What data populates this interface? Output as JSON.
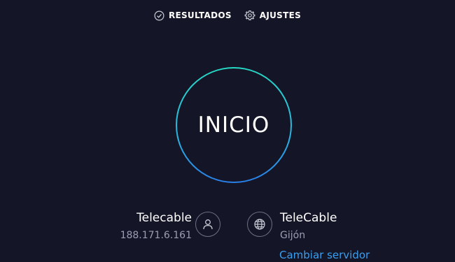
{
  "nav": {
    "results": {
      "label": "RESULTADOS",
      "icon": "check-circle-icon"
    },
    "settings": {
      "label": "AJUSTES",
      "icon": "gear-icon"
    }
  },
  "go_button": {
    "label": "INICIO"
  },
  "provider": {
    "name": "Telecable",
    "ip": "188.171.6.161",
    "icon": "user-icon"
  },
  "server": {
    "name": "TeleCable",
    "location": "Gijón",
    "change_label": "Cambiar servidor",
    "icon": "globe-icon"
  },
  "colors": {
    "background": "#141526",
    "ring_gradient": [
      "#26d8c4",
      "#2bb3e0",
      "#2a7ee8"
    ],
    "link": "#3a9ef0",
    "muted_text": "#9c9db2",
    "icon_border": "#6e7084"
  }
}
